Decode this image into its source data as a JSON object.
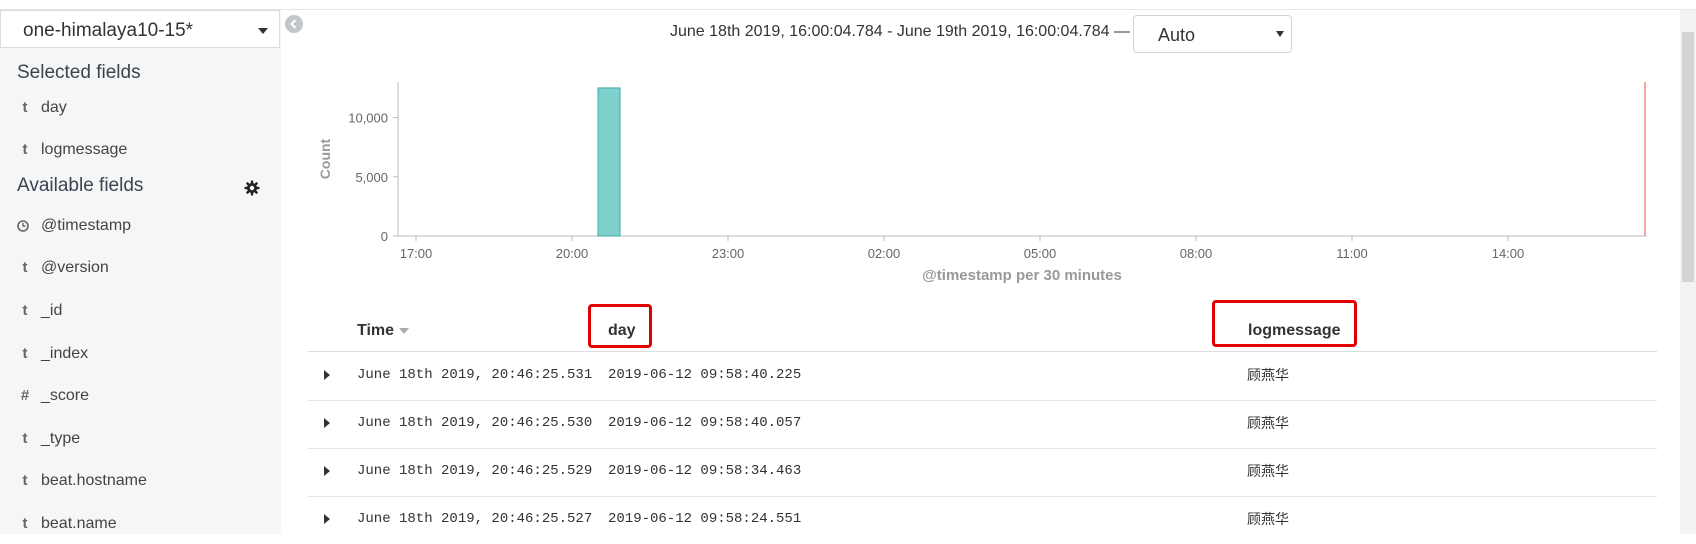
{
  "sidebar": {
    "index_pattern": "one-himalaya10-15*",
    "selected_title": "Selected fields",
    "selected_fields": [
      {
        "type": "t",
        "name": "day"
      },
      {
        "type": "t",
        "name": "logmessage"
      }
    ],
    "available_title": "Available fields",
    "available_fields": [
      {
        "type": "clock-icon",
        "name": "@timestamp"
      },
      {
        "type": "t",
        "name": "@version"
      },
      {
        "type": "t",
        "name": "_id"
      },
      {
        "type": "t",
        "name": "_index"
      },
      {
        "type": "#",
        "name": "_score"
      },
      {
        "type": "t",
        "name": "_type"
      },
      {
        "type": "t",
        "name": "beat.hostname"
      },
      {
        "type": "t",
        "name": "beat.name"
      }
    ]
  },
  "header": {
    "time_range": "June 18th 2019, 16:00:04.784 - June 19th 2019, 16:00:04.784 —",
    "interval": "Auto"
  },
  "chart_data": {
    "type": "bar",
    "x": [
      "20:30"
    ],
    "values": [
      12500
    ],
    "ylabel": "Count",
    "xlabel": "@timestamp per 30 minutes",
    "yticks": [
      "10,000",
      "5,000",
      "0"
    ],
    "xticks": [
      "17:00",
      "20:00",
      "23:00",
      "02:00",
      "05:00",
      "08:00",
      "11:00",
      "14:00"
    ],
    "ylim": [
      0,
      13000
    ],
    "bar_color": "#7fd1cd",
    "now_marker_color": "#f4a6a6"
  },
  "table": {
    "columns": [
      "Time",
      "day",
      "logmessage"
    ],
    "rows": [
      {
        "time": "June 18th 2019, 20:46:25.531",
        "day": "2019-06-12 09:58:40.225",
        "logmessage": "顾燕华"
      },
      {
        "time": "June 18th 2019, 20:46:25.530",
        "day": "2019-06-12 09:58:40.057",
        "logmessage": "顾燕华"
      },
      {
        "time": "June 18th 2019, 20:46:25.529",
        "day": "2019-06-12 09:58:34.463",
        "logmessage": "顾燕华"
      },
      {
        "time": "June 18th 2019, 20:46:25.527",
        "day": "2019-06-12 09:58:24.551",
        "logmessage": "顾燕华"
      }
    ]
  },
  "colors": {
    "highlight": "#e00000",
    "sidebar_bg": "#f4f6f8"
  }
}
